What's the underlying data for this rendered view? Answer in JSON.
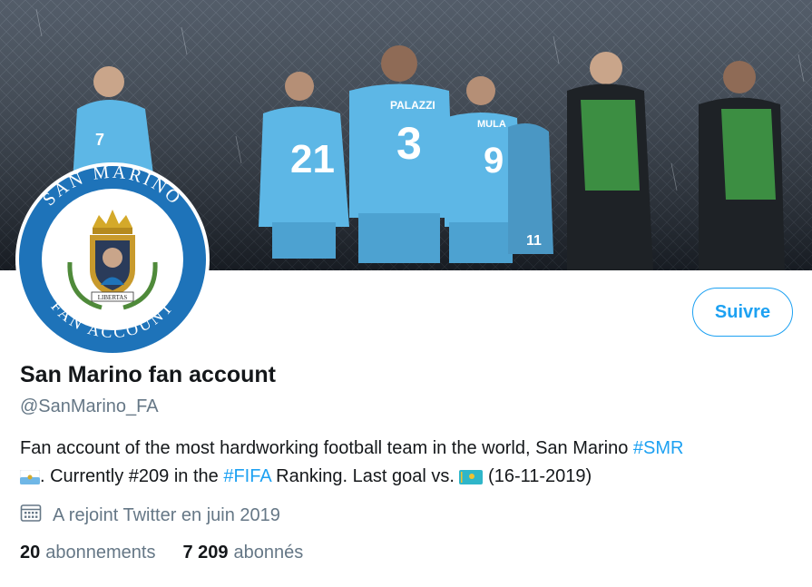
{
  "profile": {
    "name": "San Marino fan account",
    "handle": "@SanMarino_FA",
    "follow_label": "Suivre",
    "joined": "A rejoint Twitter en juin 2019"
  },
  "bio": {
    "part1": "Fan account of the most hardworking football team in the world, San Marino ",
    "tag_smr": "#SMR",
    "part2": ". Currently #209 in the ",
    "tag_fifa": "#FIFA",
    "part3": " Ranking. Last goal vs. ",
    "part4": " (16-11-2019)"
  },
  "stats": {
    "following_count": "20",
    "following_label": "abonnements",
    "followers_count": "7 209",
    "followers_label": "abonnés"
  },
  "avatar": {
    "ring_top": "SAN MARINO",
    "ring_bottom": "FAN ACCOUNT",
    "motto": "LIBERTAS"
  },
  "banner": {
    "jersey_numbers": [
      "7",
      "21",
      "3",
      "9",
      "11"
    ],
    "jersey_name": "PALAZZI",
    "jersey_name_2": "MULA"
  },
  "icons": {
    "calendar": "calendar-icon",
    "flag_sm": "san-marino-flag-icon",
    "flag_kz": "kazakhstan-flag-icon"
  },
  "colors": {
    "accent": "#1da1f2",
    "text": "#14171a",
    "muted": "#657786",
    "jersey": "#5db7e6"
  }
}
